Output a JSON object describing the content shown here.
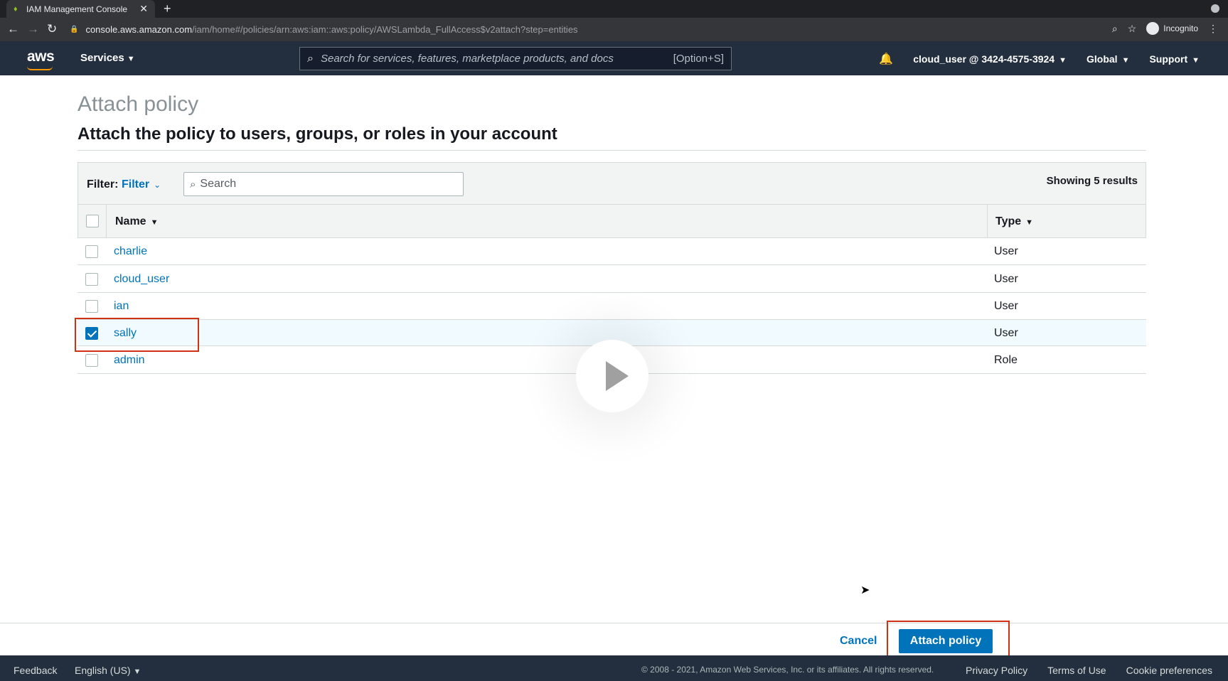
{
  "browser": {
    "tab_title": "IAM Management Console",
    "url_host": "console.aws.amazon.com",
    "url_path": "/iam/home#/policies/arn:aws:iam::aws:policy/AWSLambda_FullAccess$v2attach?step=entities",
    "incognito_label": "Incognito"
  },
  "nav": {
    "logo": "aws",
    "services": "Services",
    "search_placeholder": "Search for services, features, marketplace products, and docs",
    "search_hint": "[Option+S]",
    "account": "cloud_user @ 3424-4575-3924",
    "region": "Global",
    "support": "Support"
  },
  "page": {
    "title": "Attach policy",
    "subtitle": "Attach the policy to users, groups, or roles in your account"
  },
  "filter": {
    "label": "Filter:",
    "value": "Filter",
    "search_placeholder": "Search",
    "results": "Showing 5 results"
  },
  "table": {
    "headers": {
      "name": "Name",
      "type": "Type"
    },
    "rows": [
      {
        "name": "charlie",
        "type": "User",
        "checked": false
      },
      {
        "name": "cloud_user",
        "type": "User",
        "checked": false
      },
      {
        "name": "ian",
        "type": "User",
        "checked": false
      },
      {
        "name": "sally",
        "type": "User",
        "checked": true
      },
      {
        "name": "admin",
        "type": "Role",
        "checked": false
      }
    ]
  },
  "actions": {
    "cancel": "Cancel",
    "attach": "Attach policy"
  },
  "footer": {
    "feedback": "Feedback",
    "language": "English (US)",
    "copyright": "© 2008 - 2021, Amazon Web Services, Inc. or its affiliates. All rights reserved.",
    "privacy": "Privacy Policy",
    "terms": "Terms of Use",
    "cookies": "Cookie preferences"
  },
  "colors": {
    "link": "#0073bb",
    "nav_bg": "#232f3e",
    "highlight": "#d13212",
    "selected_row": "#f1faff"
  }
}
